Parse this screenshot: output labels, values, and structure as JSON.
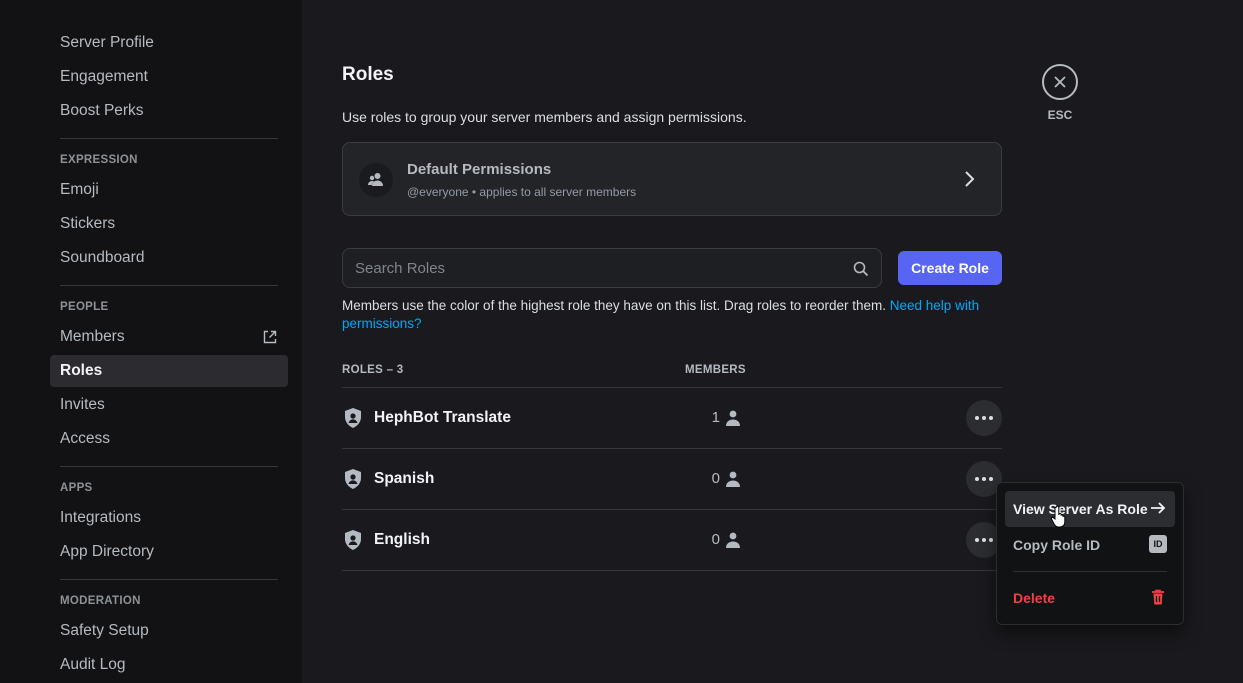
{
  "sidebar": {
    "items": [
      {
        "label": "Server Profile"
      },
      {
        "label": "Engagement"
      },
      {
        "label": "Boost Perks"
      },
      {
        "label": "Emoji"
      },
      {
        "label": "Stickers"
      },
      {
        "label": "Soundboard"
      },
      {
        "label": "Members"
      },
      {
        "label": "Roles",
        "active": true
      },
      {
        "label": "Invites"
      },
      {
        "label": "Access"
      },
      {
        "label": "Integrations"
      },
      {
        "label": "App Directory"
      },
      {
        "label": "Safety Setup"
      },
      {
        "label": "Audit Log"
      }
    ],
    "headers": {
      "expression": "EXPRESSION",
      "people": "PEOPLE",
      "apps": "APPS",
      "moderation": "MODERATION"
    }
  },
  "main": {
    "title": "Roles",
    "description": "Use roles to group your server members and assign permissions.",
    "default_permissions": {
      "title": "Default Permissions",
      "subtitle": "@everyone • applies to all server members"
    },
    "search": {
      "placeholder": "Search Roles",
      "value": ""
    },
    "create_button": "Create Role",
    "hint_text": "Members use the color of the highest role they have on this list. Drag roles to reorder them. ",
    "hint_link": "Need help with permissions?",
    "table": {
      "roles_header": "ROLES – 3",
      "members_header": "MEMBERS",
      "rows": [
        {
          "name": "HephBot Translate",
          "members": "1"
        },
        {
          "name": "Spanish",
          "members": "0"
        },
        {
          "name": "English",
          "members": "0"
        }
      ]
    }
  },
  "close": {
    "label": "ESC"
  },
  "context_menu": {
    "items": [
      {
        "label": "View Server As Role"
      },
      {
        "label": "Copy Role ID",
        "icon_text": "ID"
      },
      {
        "label": "Delete"
      }
    ]
  },
  "colors": {
    "accent": "#5865f2",
    "link": "#00a8fc",
    "danger": "#f23f43",
    "background": "#1a1a1e",
    "sidebar": "#121214"
  }
}
